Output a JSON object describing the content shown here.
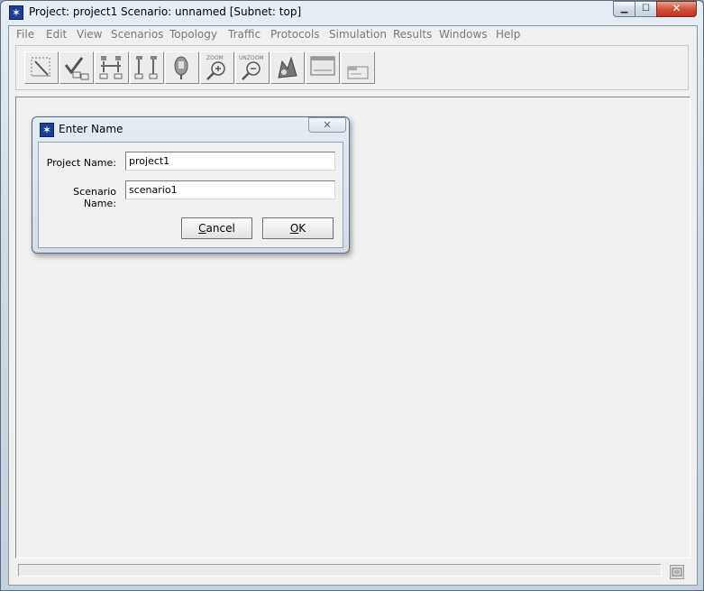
{
  "window": {
    "title": "Project: project1 Scenario: unnamed  [Subnet: top]",
    "minimize_glyph": "▁",
    "maximize_glyph": "☐",
    "close_glyph": "✕"
  },
  "menubar": {
    "items": [
      "File",
      "Edit",
      "View",
      "Scenarios",
      "Topology",
      "Traffic",
      "Protocols",
      "Simulation",
      "Results",
      "Windows",
      "Help"
    ]
  },
  "toolbar": {
    "buttons": [
      {
        "icon": "rapid-configuration-icon"
      },
      {
        "icon": "verify-links-icon"
      },
      {
        "icon": "open-object-palette-icon"
      },
      {
        "icon": "fail-node-icon"
      },
      {
        "icon": "recover-node-icon"
      },
      {
        "icon": "zoom-in-icon",
        "label": "ZOOM"
      },
      {
        "icon": "zoom-out-icon",
        "label": "UNZOOM"
      },
      {
        "icon": "configure-run-icon"
      },
      {
        "icon": "view-results-icon"
      },
      {
        "icon": "hide-graphs-icon"
      }
    ]
  },
  "dialog": {
    "title": "Enter Name",
    "close_glyph": "✕",
    "project_label": "Project Name:",
    "project_value": "project1",
    "scenario_label": "Scenario Name:",
    "scenario_value": "scenario1",
    "cancel_mnemonic": "C",
    "cancel_rest": "ancel",
    "ok_mnemonic": "O",
    "ok_rest": "K"
  },
  "colors": {
    "accent": "#1c3f96",
    "disabled_text": "#7a7a7a",
    "close_button": "#d1503a"
  }
}
